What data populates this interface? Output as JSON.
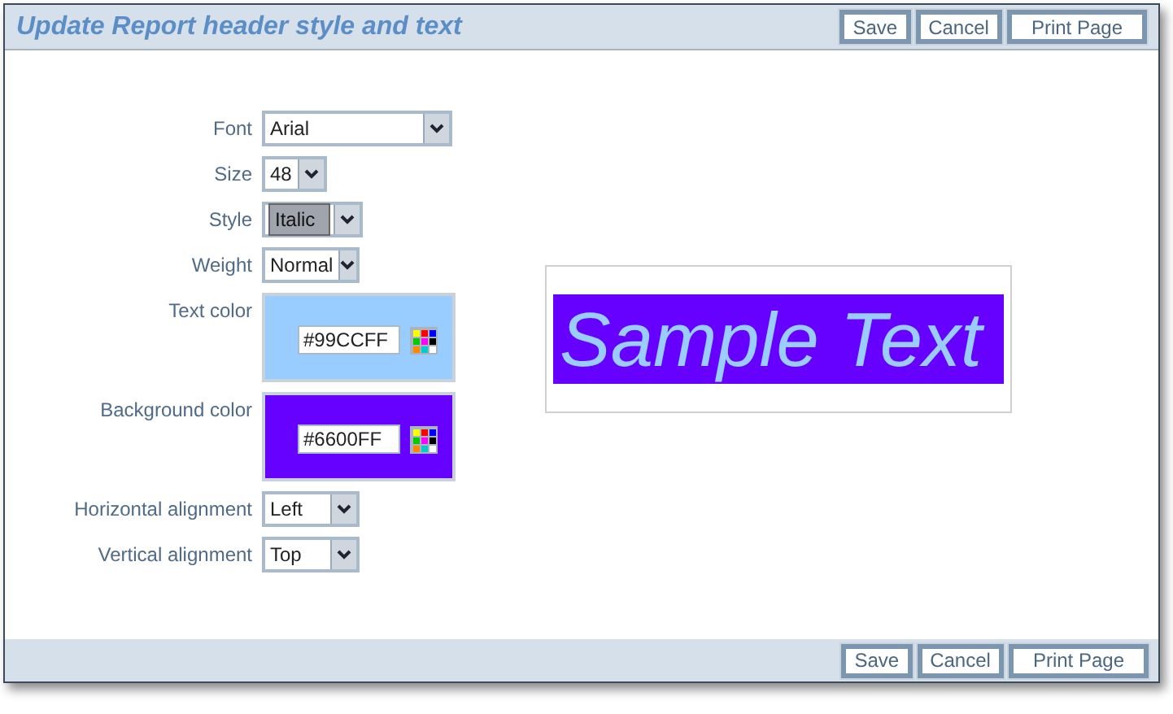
{
  "window": {
    "title": "Update Report header style and text"
  },
  "top_buttons": [
    "Save",
    "Cancel",
    "Print Page"
  ],
  "fields": [
    {
      "kind": "select",
      "label": "Font",
      "value": "Arial",
      "focused": false
    },
    {
      "kind": "select",
      "label": "Size",
      "value": "48",
      "focused": false
    },
    {
      "kind": "select",
      "label": "Style",
      "value": "Italic",
      "focused": true
    },
    {
      "kind": "select",
      "label": "Weight",
      "value": "Normal",
      "focused": false
    },
    {
      "kind": "color",
      "label": "Text color",
      "value": "#99CCFF",
      "color": "#99ccff"
    },
    {
      "kind": "color",
      "label": "Background color",
      "value": "#6600FF",
      "color": "#6600ff"
    },
    {
      "kind": "select",
      "label": "Horizontal alignment",
      "value": "Left",
      "focused": false
    },
    {
      "kind": "select",
      "label": "Vertical alignment",
      "value": "Top",
      "focused": false
    }
  ],
  "preview": {
    "text": "Sample Text",
    "italic": true
  },
  "bottom_buttons": [
    "Save",
    "Cancel",
    "Print Page"
  ]
}
